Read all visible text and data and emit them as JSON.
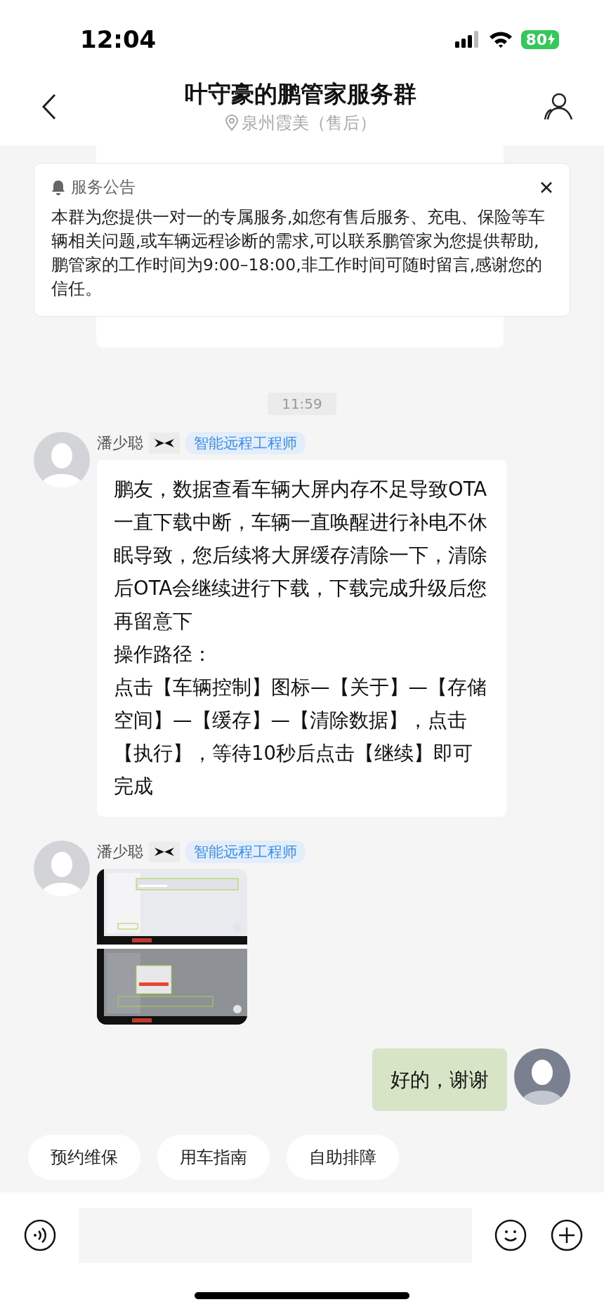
{
  "status_bar": {
    "time": "12:04",
    "battery": "80"
  },
  "header": {
    "title": "叶守豪的鹏管家服务群",
    "subtitle": "泉州霞美（售后）"
  },
  "announcement": {
    "title": "服务公告",
    "text": "本群为您提供一对一的专属服务,如您有售后服务、充电、保险等车辆相关问题,或车辆远程诊断的需求,可以联系鹏管家为您提供帮助,鹏管家的工作时间为9:00–18:00,非工作时间可随时留言,感谢您的信任。"
  },
  "messages": [
    {
      "kind": "time",
      "text": "11:59"
    },
    {
      "kind": "text",
      "outgoing": false,
      "sender": "潘少聪",
      "role": "智能远程工程师",
      "paragraphs": [
        "鹏友，数据查看车辆大屏内存不足导致OTA一直下载中断，车辆一直唤醒进行补电不休眠导致，您后续将大屏缓存清除一下，清除后OTA会继续进行下载，下载完成升级后您再留意下",
        "操作路径：",
        "点击【车辆控制】图标—【关于】—【存储空间】—【缓存】—【清除数据】，点击【执行】，等待10秒后点击【继续】即可完成"
      ]
    },
    {
      "kind": "images",
      "outgoing": false,
      "sender": "潘少聪",
      "role": "智能远程工程师"
    },
    {
      "kind": "text",
      "outgoing": true,
      "paragraphs": [
        "好的，谢谢"
      ]
    }
  ],
  "quick_replies": [
    "预约维保",
    "用车指南",
    "自助排障"
  ]
}
